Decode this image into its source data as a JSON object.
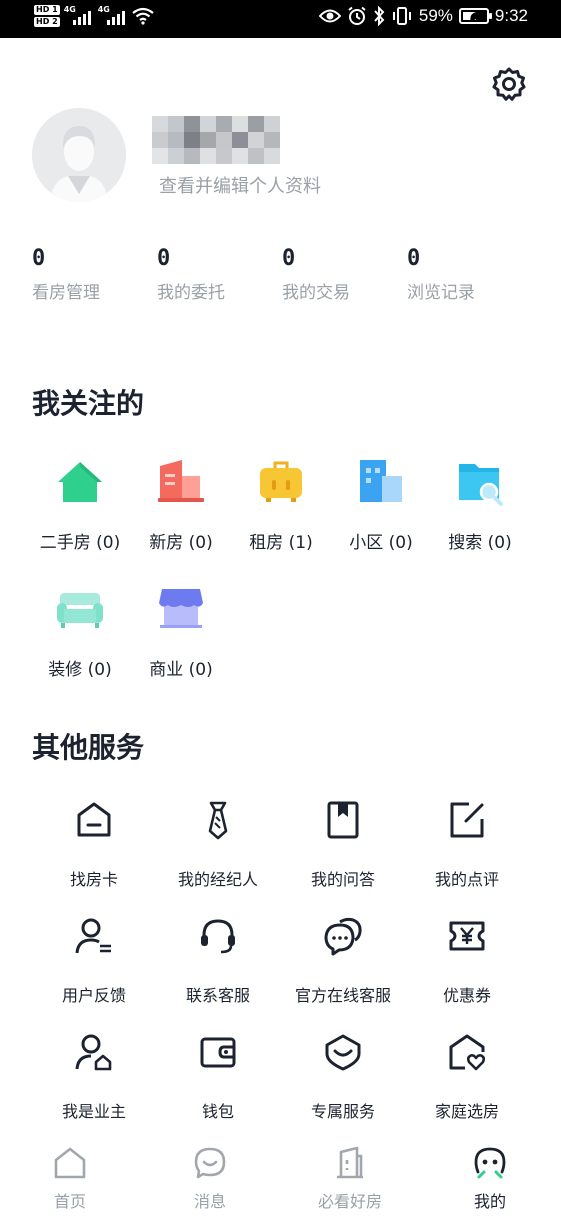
{
  "status_bar": {
    "hd1": "HD 1",
    "hd2": "HD 2",
    "sig1": "4G",
    "sig2": "4G",
    "battery_percent": "59%",
    "battery_level": 0.59,
    "time": "9:32"
  },
  "profile": {
    "subtitle": "查看并编辑个人资料"
  },
  "stats": [
    {
      "value": "0",
      "label": "看房管理"
    },
    {
      "value": "0",
      "label": "我的委托"
    },
    {
      "value": "0",
      "label": "我的交易"
    },
    {
      "value": "0",
      "label": "浏览记录"
    }
  ],
  "follows": {
    "title": "我关注的",
    "items": [
      {
        "label": "二手房 (0)",
        "icon": "house-icon"
      },
      {
        "label": "新房 (0)",
        "icon": "building-icon"
      },
      {
        "label": "租房 (1)",
        "icon": "suitcase-icon"
      },
      {
        "label": "小区 (0)",
        "icon": "community-icon"
      },
      {
        "label": "搜索 (0)",
        "icon": "search-folder-icon"
      },
      {
        "label": "装修 (0)",
        "icon": "sofa-icon"
      },
      {
        "label": "商业 (0)",
        "icon": "shop-icon"
      }
    ]
  },
  "services": {
    "title": "其他服务",
    "items": [
      {
        "label": "找房卡",
        "icon": "house-card-icon"
      },
      {
        "label": "我的经纪人",
        "icon": "tie-icon"
      },
      {
        "label": "我的问答",
        "icon": "bookmark-book-icon"
      },
      {
        "label": "我的点评",
        "icon": "edit-icon"
      },
      {
        "label": "用户反馈",
        "icon": "user-feedback-icon"
      },
      {
        "label": "联系客服",
        "icon": "headset-icon"
      },
      {
        "label": "官方在线客服",
        "icon": "chat-bubbles-icon"
      },
      {
        "label": "优惠券",
        "icon": "coupon-icon"
      },
      {
        "label": "我是业主",
        "icon": "owner-icon"
      },
      {
        "label": "钱包",
        "icon": "wallet-icon"
      },
      {
        "label": "专属服务",
        "icon": "exclusive-service-icon"
      },
      {
        "label": "家庭选房",
        "icon": "family-house-icon"
      }
    ]
  },
  "nav": [
    {
      "label": "首页",
      "icon": "home-icon"
    },
    {
      "label": "消息",
      "icon": "message-icon"
    },
    {
      "label": "必看好房",
      "icon": "door-icon"
    },
    {
      "label": "我的",
      "icon": "profile-face-icon"
    }
  ],
  "colors": {
    "accent": "#1c2230",
    "muted": "#9aa0a8",
    "green": "#2fd08e",
    "coral": "#f56a5e",
    "yellow": "#f7c634",
    "blue": "#3aa4f3",
    "mint": "#7fe0cc",
    "purple": "#6d7af0"
  }
}
